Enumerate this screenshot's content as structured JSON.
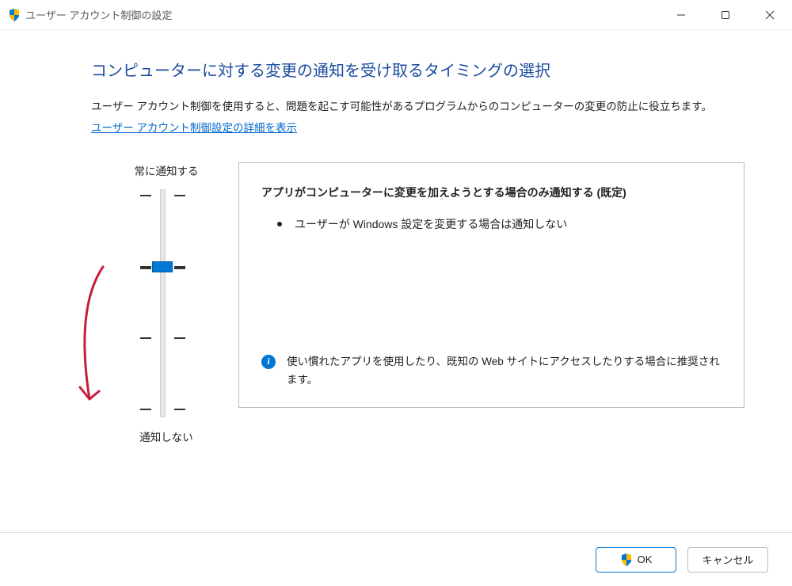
{
  "window": {
    "title": "ユーザー アカウント制御の設定"
  },
  "heading": "コンピューターに対する変更の通知を受け取るタイミングの選択",
  "description": "ユーザー アカウント制御を使用すると、問題を起こす可能性があるプログラムからのコンピューターの変更の防止に役立ちます。",
  "info_link": "ユーザー アカウント制御設定の詳細を表示",
  "slider": {
    "top_label": "常に通知する",
    "bottom_label": "通知しない",
    "selected_level": 1,
    "levels": 4
  },
  "panel": {
    "title": "アプリがコンピューターに変更を加えようとする場合のみ通知する (既定)",
    "bullet": "ユーザーが Windows 設定を変更する場合は通知しない",
    "note": "使い慣れたアプリを使用したり、既知の Web サイトにアクセスしたりする場合に推奨されます。"
  },
  "buttons": {
    "ok": "OK",
    "cancel": "キャンセル"
  }
}
